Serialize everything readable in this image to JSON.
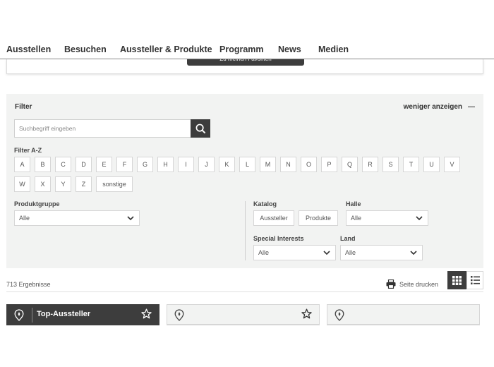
{
  "nav": {
    "items": [
      "Ausstellen",
      "Besuchen",
      "Aussteller & Produkte",
      "Programm",
      "News",
      "Medien"
    ]
  },
  "top_card": {
    "favorites_label": "Zu meinen Favoriten"
  },
  "filter": {
    "title": "Filter",
    "less_label": "weniger anzeigen",
    "search": {
      "placeholder": "Suchbegriff eingeben",
      "value": ""
    },
    "az_label": "Filter A-Z",
    "letters_row1": [
      "A",
      "B",
      "C",
      "D",
      "E",
      "F",
      "G",
      "H",
      "I",
      "J",
      "K",
      "L",
      "M",
      "N",
      "O",
      "P",
      "Q",
      "R",
      "S",
      "T",
      "U",
      "V"
    ],
    "letters_row2": [
      "W",
      "X",
      "Y",
      "Z"
    ],
    "other_label": "sonstige",
    "produktgruppe": {
      "label": "Produktgruppe",
      "value": "Alle"
    },
    "katalog": {
      "label": "Katalog",
      "options": [
        "Aussteller",
        "Produkte"
      ]
    },
    "halle": {
      "label": "Halle",
      "value": "Alle"
    },
    "special_interests": {
      "label": "Special Interests",
      "value": "Alle"
    },
    "land": {
      "label": "Land",
      "value": "Alle"
    }
  },
  "results": {
    "count_text": "713 Ergebnisse",
    "print_label": "Seite drucken"
  },
  "cards": [
    {
      "title": "Top-Aussteller",
      "highlighted": true
    },
    {
      "title": "",
      "highlighted": false
    },
    {
      "title": "",
      "highlighted": false
    }
  ],
  "colors": {
    "dark": "#3d3d3d",
    "panel": "#f2f3f2",
    "border": "#d6d6d6"
  }
}
